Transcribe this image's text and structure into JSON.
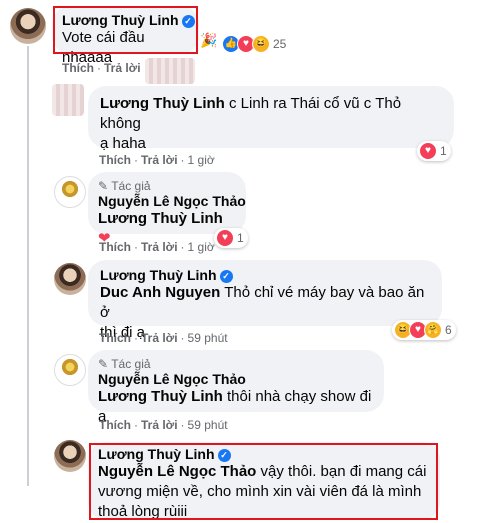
{
  "comment1": {
    "author": "Lương Thuỳ Linh",
    "text": "Vote cái đầu nhaaaa",
    "emoji": "🎉",
    "reaction_count": "25",
    "actions": {
      "like": "Thích",
      "reply": "Trả lời"
    }
  },
  "reply1": {
    "author": "Lương Thuỳ Linh",
    "text_line1": "c Linh ra Thái cổ vũ c Thỏ không",
    "text_line2": "ạ haha",
    "actions": {
      "like": "Thích",
      "reply": "Trả lời",
      "time": "1 giờ"
    },
    "reaction_count": "1"
  },
  "reply2": {
    "tag": "Tác giả",
    "author": "Nguyễn Lê Ngọc Thảo",
    "mention": "Lương Thuỳ Linh",
    "emoji": "❤",
    "actions": {
      "like": "Thích",
      "reply": "Trả lời",
      "time": "1 giờ"
    },
    "reaction_count": "1"
  },
  "reply3": {
    "author": "Lương Thuỳ Linh",
    "mention": "Duc Anh Nguyen",
    "text_line1": "Thỏ chỉ vé máy bay và bao ăn ở",
    "text_line2": "thì đi ạ",
    "actions": {
      "like": "Thích",
      "reply": "Trả lời",
      "time": "59 phút"
    },
    "reaction_count": "6"
  },
  "reply4": {
    "tag": "Tác giả",
    "author": "Nguyễn Lê Ngọc Thảo",
    "mention": "Lương Thuỳ Linh",
    "text": "thôi nhà chạy show đi ạ",
    "actions": {
      "like": "Thích",
      "reply": "Trả lời",
      "time": "59 phút"
    }
  },
  "reply5": {
    "author": "Lương Thuỳ Linh",
    "mention": "Nguyễn Lê Ngọc Thảo",
    "text_line1": "vậy thôi. bạn đi mang cái",
    "text_line2": "vương miện về, cho mình xin vài viên đá là mình",
    "text_line3": "thoả lòng rùiii"
  },
  "colors": {
    "highlight": "#e0161e",
    "bubble": "#f0f2f5",
    "verified": "#1877f2",
    "meta": "#65676b"
  }
}
